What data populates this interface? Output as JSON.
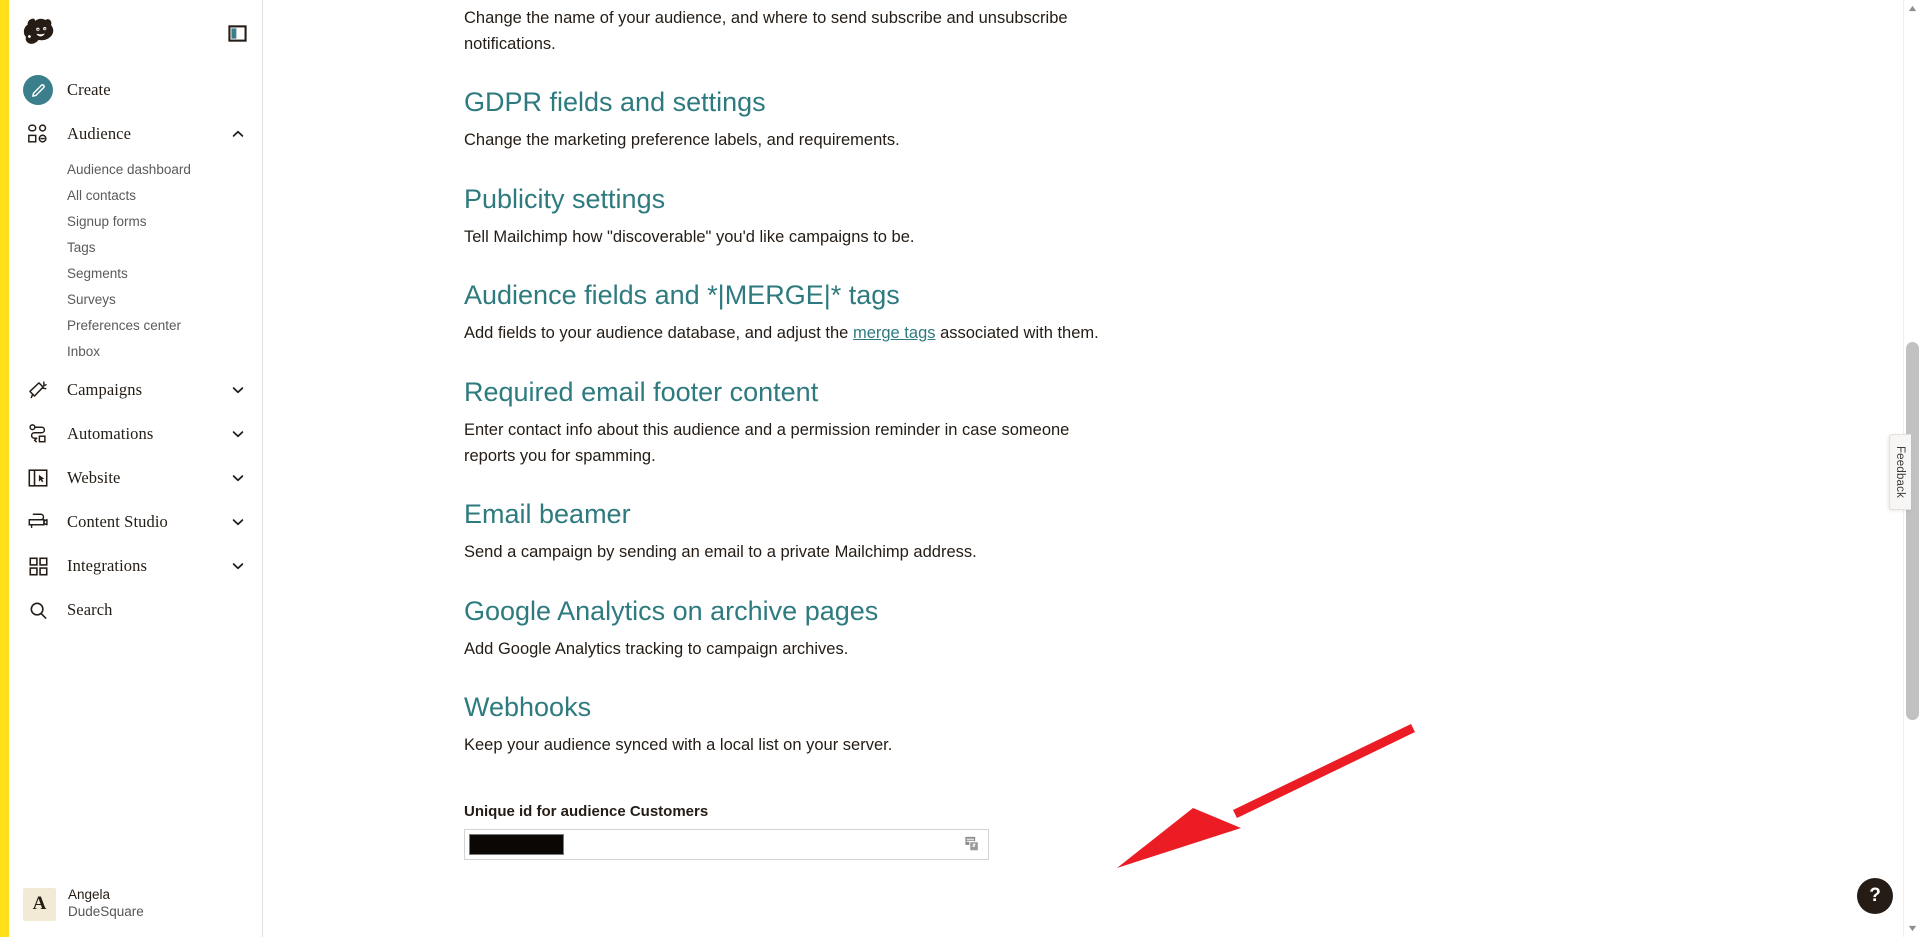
{
  "app": {
    "brand": "Mailchimp",
    "accent_yellow": "#ffe01b",
    "accent_teal": "#2d7a7f",
    "text_dark": "#241c15",
    "annotation_red": "#ec1c24"
  },
  "sidebar": {
    "logo_icon": "mailchimp-freddie-logo",
    "panel_toggle_icon": "panel-toggle-icon",
    "primary_items": [
      {
        "label": "Create",
        "icon": "pencil-icon",
        "chevron": "",
        "expanded": false
      },
      {
        "label": "Audience",
        "icon": "audience-icon",
        "chevron": "chevron-up-icon",
        "expanded": true
      },
      {
        "label": "Campaigns",
        "icon": "megaphone-icon",
        "chevron": "chevron-down-icon",
        "expanded": false
      },
      {
        "label": "Automations",
        "icon": "automations-icon",
        "chevron": "chevron-down-icon",
        "expanded": false
      },
      {
        "label": "Website",
        "icon": "website-icon",
        "chevron": "chevron-down-icon",
        "expanded": false
      },
      {
        "label": "Content Studio",
        "icon": "content-studio-icon",
        "chevron": "chevron-down-icon",
        "expanded": false
      },
      {
        "label": "Integrations",
        "icon": "integrations-grid-icon",
        "chevron": "chevron-down-icon",
        "expanded": false
      },
      {
        "label": "Search",
        "icon": "search-icon",
        "chevron": "",
        "expanded": false
      }
    ],
    "audience_subitems": [
      {
        "label": "Audience dashboard"
      },
      {
        "label": "All contacts"
      },
      {
        "label": "Signup forms"
      },
      {
        "label": "Tags"
      },
      {
        "label": "Segments"
      },
      {
        "label": "Surveys"
      },
      {
        "label": "Preferences center"
      },
      {
        "label": "Inbox"
      }
    ],
    "user": {
      "avatar_initial": "A",
      "name": "Angela",
      "org": "DudeSquare"
    }
  },
  "main": {
    "lede": "Change the name of your audience, and where to send subscribe and unsubscribe notifications.",
    "sections": [
      {
        "title": "GDPR fields and settings",
        "desc": "Change the marketing preference labels, and requirements."
      },
      {
        "title": "Publicity settings",
        "desc": "Tell Mailchimp how \"discoverable\" you'd like campaigns to be."
      },
      {
        "title": "Audience fields and *|MERGE|* tags",
        "desc_before": "Add fields to your audience database, and adjust the ",
        "desc_link": "merge tags",
        "desc_after": " associated with them."
      },
      {
        "title": "Required email footer content",
        "desc": "Enter contact info about this audience and a permission reminder in case someone reports you for spamming."
      },
      {
        "title": "Email beamer",
        "desc": "Send a campaign by sending an email to a private Mailchimp address."
      },
      {
        "title": "Google Analytics on archive pages",
        "desc": "Add Google Analytics tracking to campaign archives."
      },
      {
        "title": "Webhooks",
        "desc": "Keep your audience synced with a local list on your server."
      }
    ],
    "unique_id_field": {
      "label": "Unique id for audience Customers",
      "value": "",
      "placeholder": "",
      "redacted": true,
      "copy_icon": "copy-icon"
    }
  },
  "feedback": {
    "label": "Feedback"
  },
  "help": {
    "label": "?",
    "icon": "question-mark-icon"
  },
  "scrollbar": {
    "up_icon": "scroll-up-arrow-icon",
    "down_icon": "scroll-down-arrow-icon"
  },
  "annotation": {
    "type": "red-arrow",
    "points_to": "unique-id-copy-field"
  }
}
